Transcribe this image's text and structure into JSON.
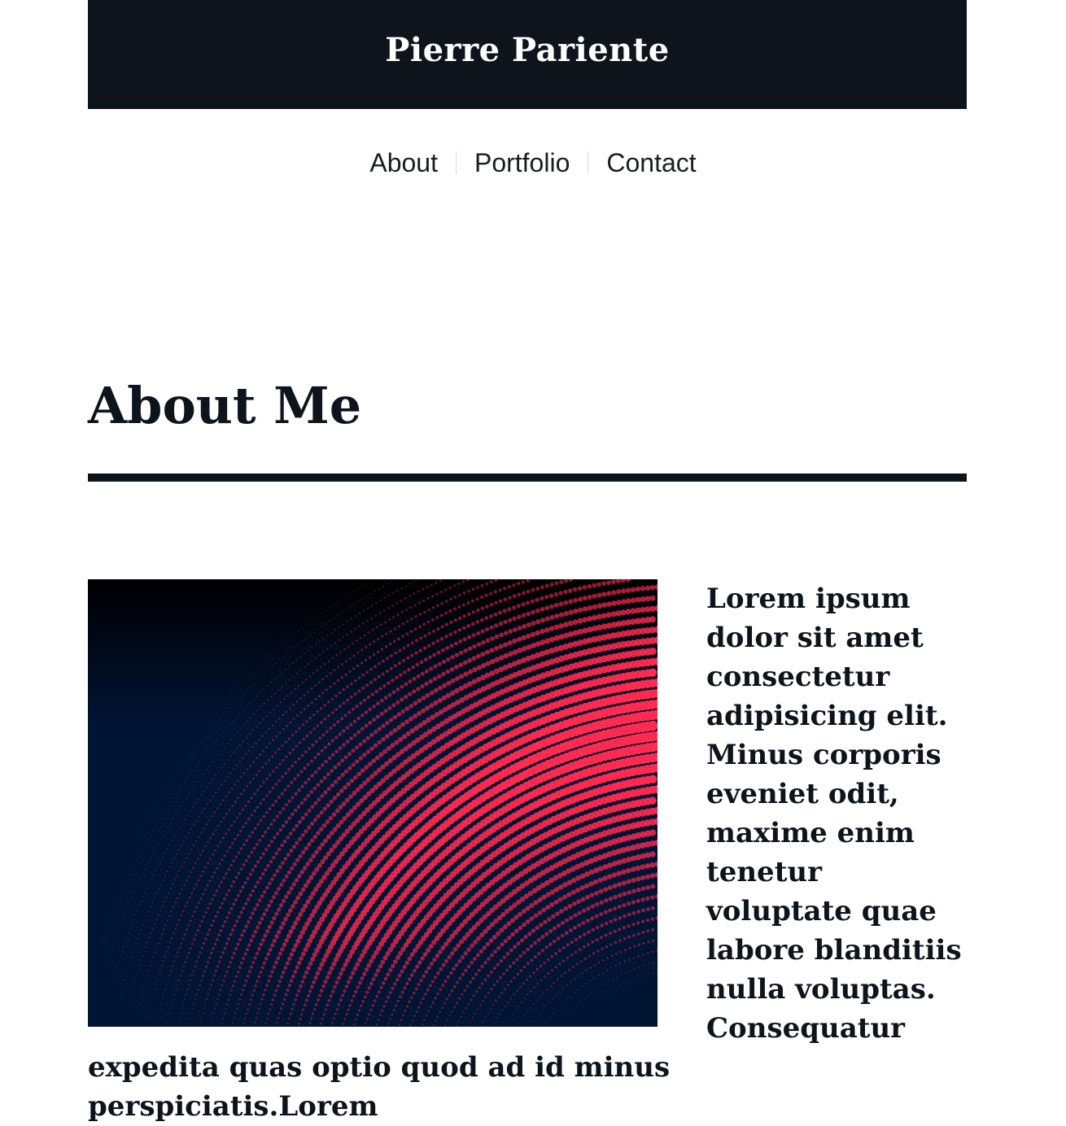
{
  "header": {
    "site_title": "Pierre Pariente"
  },
  "nav": {
    "items": [
      {
        "label": "About"
      },
      {
        "label": "Portfolio"
      },
      {
        "label": "Contact"
      }
    ]
  },
  "main": {
    "heading": "About Me",
    "paragraph": "Lorem ipsum dolor sit amet consectetur adipisicing elit. Minus corporis eveniet odit, maxime enim tenetur voluptate quae labore blanditiis nulla voluptas. Consequatur expedita quas optio quod ad id minus perspiciatis.Lorem"
  },
  "colors": {
    "header_bg": "#0e141c",
    "text": "#0e141c",
    "image_bg": "#001433",
    "image_accent": "#ff2a4f"
  }
}
